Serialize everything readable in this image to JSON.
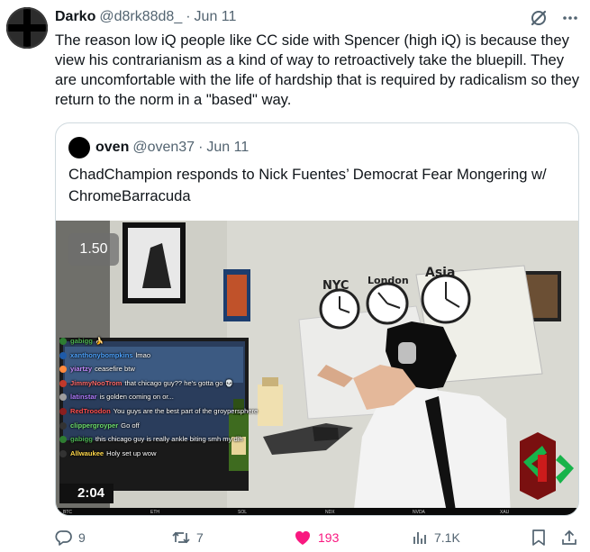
{
  "tweet": {
    "author_name": "Darko",
    "author_handle": "@d8rk88d8_",
    "separator": "·",
    "date": "Jun 11",
    "text": "The reason low iQ people like CC side with Spencer (high iQ) is because they view his contrarianism as a kind of way to retroactively take the bluepill. They are uncomfortable with the life of hardship that is required by radicalism so they return to the norm in a \"based\" way.",
    "header_icons": [
      "grok-icon",
      "more-icon"
    ]
  },
  "quote": {
    "author_name": "oven",
    "author_handle": "@oven37",
    "separator": "·",
    "date": "Jun 11",
    "text": "ChadChampion responds to Nick Fuentes’ Democrat Fear Mongering w/ ChromeBarracuda"
  },
  "media": {
    "playback_speed": "1.50",
    "timer": "2:04",
    "clocks": [
      "NYC",
      "London",
      "Asia"
    ],
    "chat": [
      {
        "user": "gabigg",
        "message": "🍌",
        "color": "#4caf50",
        "badge": "#2e7d32"
      },
      {
        "user": "xanthonybompkins",
        "message": "lmao",
        "color": "#4da3ff",
        "badge": "#1e5aa8"
      },
      {
        "user": "yiartzy",
        "message": "ceasefire btw",
        "color": "#c58cff",
        "badge": "#ff8a3d"
      },
      {
        "user": "JimmyNooTrom",
        "message": "that chicago guy?? he's gotta go 💀",
        "color": "#ff6a6a",
        "badge": "#c0392b"
      },
      {
        "user": "latinstar",
        "message": "is golden coming on or...",
        "color": "#b07cff",
        "badge": "#9e9e9e"
      },
      {
        "user": "RedTroodon",
        "message": "You guys are the best part of the groypersphere",
        "color": "#ff4f4f",
        "badge": "#8b1f1f"
      },
      {
        "user": "clippergroyper",
        "message": "Go off",
        "color": "#6ee06e",
        "badge": "#333333"
      },
      {
        "user": "gabigg",
        "message": "this chicago guy is really ankle biting smh my dih",
        "color": "#4caf50",
        "badge": "#2e7d32"
      },
      {
        "user": "Allwaukee",
        "message": "Holy set up wow",
        "color": "#ffd84a",
        "badge": "#333333"
      }
    ],
    "ticker": [
      "BTC",
      "ETH",
      "SOL",
      "NDX",
      "NVDA",
      "XAU"
    ]
  },
  "actions": {
    "replies": "9",
    "reposts": "7",
    "likes": "193",
    "views": "7.1K"
  },
  "colors": {
    "like_active": "#f91880",
    "secondary_text": "#536471",
    "border": "#cfd9de"
  }
}
